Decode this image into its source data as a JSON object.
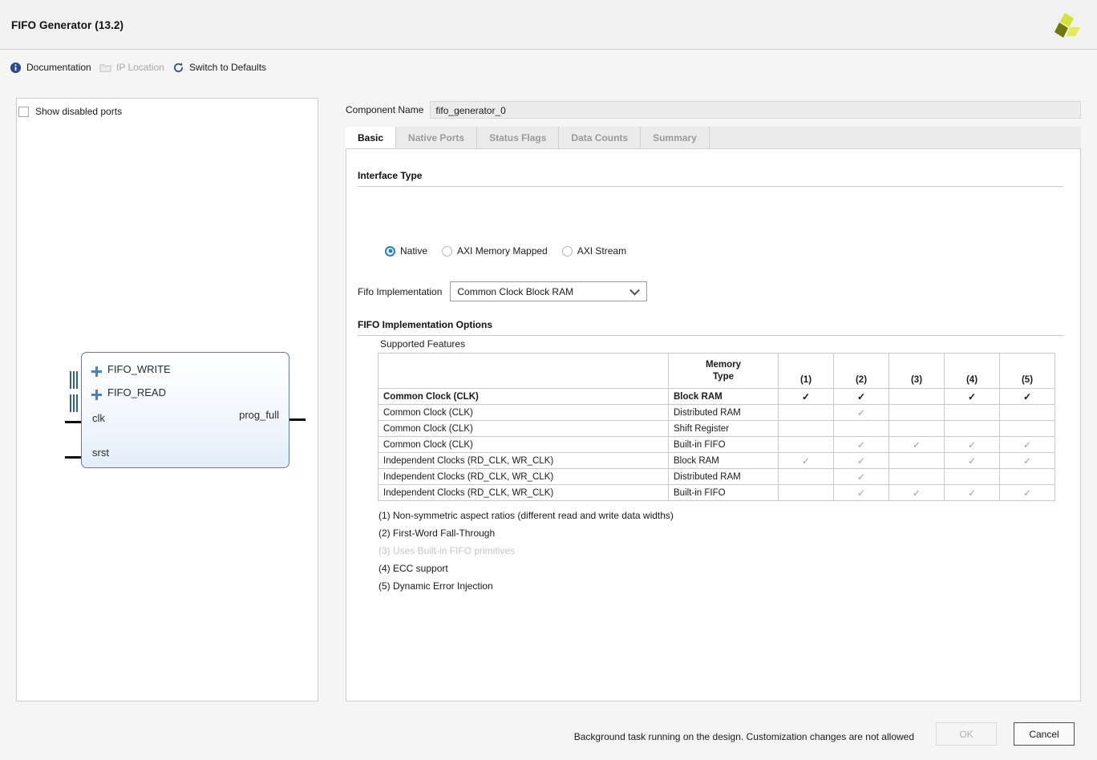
{
  "window": {
    "title": "FIFO Generator (13.2)",
    "logo_icon": "xilinx-tri-blade-logo"
  },
  "toolbar": {
    "items": [
      {
        "label": "Documentation",
        "icon": "info-circle-icon",
        "disabled": false
      },
      {
        "label": "IP Location",
        "icon": "folder-icon",
        "disabled": true
      },
      {
        "label": "Switch to Defaults",
        "icon": "refresh-icon",
        "disabled": false
      }
    ]
  },
  "left_panel": {
    "show_disabled_ports": {
      "label": "Show disabled ports",
      "checked": false
    },
    "symbol": {
      "buses": [
        {
          "label": "FIFO_WRITE",
          "expander": "plus-icon"
        },
        {
          "label": "FIFO_READ",
          "expander": "plus-icon"
        }
      ],
      "inputs": [
        "clk",
        "srst"
      ],
      "outputs": [
        "prog_full"
      ]
    }
  },
  "component_name": {
    "label": "Component Name",
    "value": "fifo_generator_0"
  },
  "tabs": [
    {
      "label": "Basic",
      "active": true
    },
    {
      "label": "Native Ports",
      "active": false
    },
    {
      "label": "Status Flags",
      "active": false
    },
    {
      "label": "Data Counts",
      "active": false
    },
    {
      "label": "Summary",
      "active": false
    }
  ],
  "interface_type": {
    "heading": "Interface Type",
    "options": [
      {
        "label": "Native",
        "selected": true
      },
      {
        "label": "AXI Memory Mapped",
        "selected": false
      },
      {
        "label": "AXI Stream",
        "selected": false
      }
    ]
  },
  "fifo_implementation": {
    "label": "Fifo Implementation",
    "value": "Common Clock Block RAM",
    "chevron_icon": "chevron-down-icon"
  },
  "implementation_options": {
    "heading": "FIFO Implementation Options",
    "table_label": "Supported Features",
    "columns": [
      "",
      "Memory Type",
      "(1)",
      "(2)",
      "(3)",
      "(4)",
      "(5)"
    ],
    "memory_type_head_line1": "Memory",
    "memory_type_head_line2": "Type",
    "check_glyph": "✓",
    "rows": [
      {
        "feature": "Common Clock (CLK)",
        "memory_type": "Block RAM",
        "marks": [
          true,
          true,
          false,
          true,
          true
        ],
        "active": true
      },
      {
        "feature": "Common Clock (CLK)",
        "memory_type": "Distributed RAM",
        "marks": [
          false,
          true,
          false,
          false,
          false
        ],
        "active": false
      },
      {
        "feature": "Common Clock (CLK)",
        "memory_type": "Shift Register",
        "marks": [
          false,
          false,
          false,
          false,
          false
        ],
        "active": false
      },
      {
        "feature": "Common Clock (CLK)",
        "memory_type": "Built-in FIFO",
        "marks": [
          false,
          true,
          true,
          true,
          true
        ],
        "active": false
      },
      {
        "feature": "Independent Clocks (RD_CLK, WR_CLK)",
        "memory_type": "Block RAM",
        "marks": [
          true,
          true,
          false,
          true,
          true
        ],
        "active": false
      },
      {
        "feature": "Independent Clocks (RD_CLK, WR_CLK)",
        "memory_type": "Distributed RAM",
        "marks": [
          false,
          true,
          false,
          false,
          false
        ],
        "active": false
      },
      {
        "feature": "Independent Clocks (RD_CLK, WR_CLK)",
        "memory_type": "Built-in FIFO",
        "marks": [
          false,
          true,
          true,
          true,
          true
        ],
        "active": false
      }
    ],
    "footnotes": [
      {
        "text": "(1) Non-symmetric aspect ratios (different read and write data widths)",
        "dim": false
      },
      {
        "text": "(2) First-Word Fall-Through",
        "dim": false
      },
      {
        "text": "(3) Uses Built-in FIFO primitives",
        "dim": true
      },
      {
        "text": "(4) ECC support",
        "dim": false
      },
      {
        "text": "(5) Dynamic Error Injection",
        "dim": false
      }
    ]
  },
  "footer": {
    "status": "Background task running on the design. Customization changes are not allowed",
    "ok_label": "OK",
    "ok_disabled": true,
    "cancel_label": "Cancel"
  },
  "colors": {
    "accent_blue": "#1f7fd4",
    "symbol_border": "#5b7da6",
    "logo_light": "#d6e03a",
    "logo_mid": "#c3cf22",
    "logo_dark": "#6e7a08",
    "disabled_text": "#a8a8a8"
  }
}
